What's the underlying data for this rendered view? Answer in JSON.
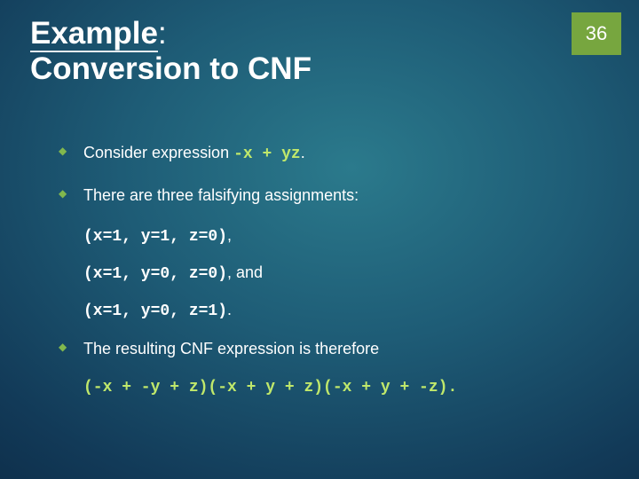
{
  "pageNumber": "36",
  "title": {
    "part1": "Example",
    "colon": ":",
    "part2": "Conversion to CNF"
  },
  "bullets": {
    "b1_prefix": "Consider expression ",
    "b1_expr": "-x + yz",
    "b1_suffix": ".",
    "b2": "There are three falsifying assignments:",
    "sub1_code": "(x=1, y=1, z=0)",
    "sub1_tail": ",",
    "sub2_code": "(x=1, y=0, z=0)",
    "sub2_tail": ", and",
    "sub3_code": "(x=1, y=0, z=1)",
    "sub3_tail": ".",
    "b3": "The resulting CNF expression is therefore",
    "result": "(-x + -y + z)(-x + y + z)(-x + y + -z)."
  }
}
